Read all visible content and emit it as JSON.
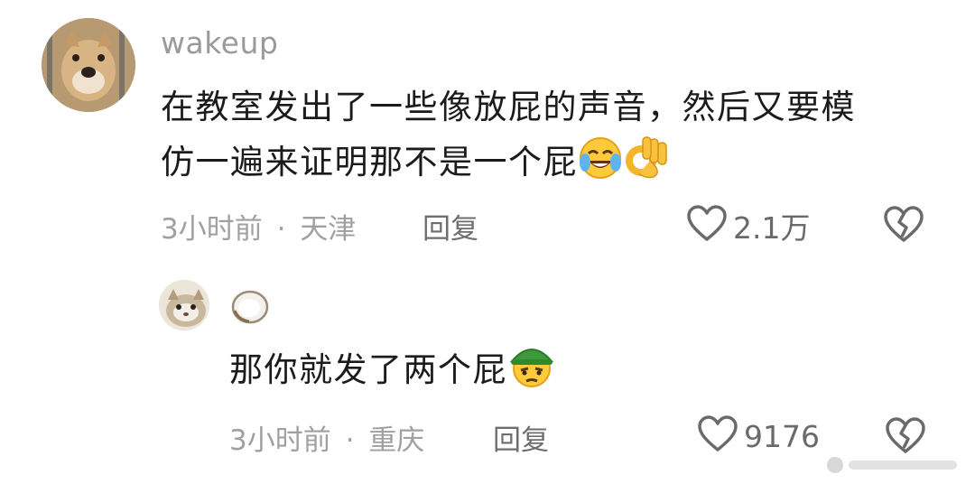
{
  "comment": {
    "username": "wakeup",
    "text_line1": "在教室发出了一些像放屁的声音，然后又要模",
    "text_line2": "仿一遍来证明那不是一个屁",
    "time": "3小时前",
    "dot": "·",
    "location": "天津",
    "reply_label": "回复",
    "likes": "2.1万",
    "emojis": [
      "rofl-emoji",
      "ok-hand-emoji"
    ]
  },
  "reply": {
    "username_icon": "coconut-icon",
    "text": "那你就发了两个屁",
    "time": "3小时前",
    "dot": "·",
    "location": "重庆",
    "reply_label": "回复",
    "likes": "9176",
    "emojis": [
      "green-hat-emoji"
    ]
  },
  "colors": {
    "meta_gray": "#a0a0a0",
    "icon_gray": "#6a6a6a",
    "text_dark": "#1b1b1b"
  }
}
